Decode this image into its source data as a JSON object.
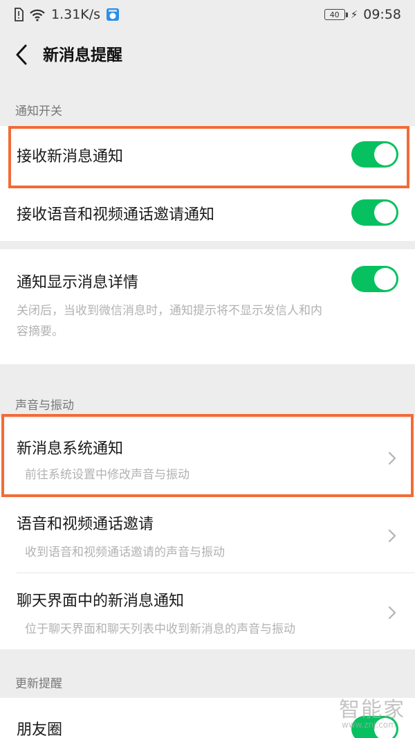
{
  "status_bar": {
    "speed": "1.31K/s",
    "battery": "40",
    "time": "09:58",
    "icons": [
      "sim-alert-icon",
      "wifi-icon",
      "app-notification-icon",
      "charging-icon"
    ]
  },
  "header": {
    "title": "新消息提醒"
  },
  "sections": {
    "notify": {
      "header": "通知开关",
      "items": [
        {
          "title": "接收新消息通知",
          "toggle": true
        },
        {
          "title": "接收语音和视频通话邀请通知",
          "toggle": true
        }
      ]
    },
    "detail": {
      "title": "通知显示消息详情",
      "toggle": true,
      "desc_line1": "关闭后，当收到微信消息时，通知提示将不显示发信人和内",
      "desc_line2": "容摘要。"
    },
    "sound": {
      "header": "声音与振动",
      "items": [
        {
          "title": "新消息系统通知",
          "subtitle": "前往系统设置中修改声音与振动"
        },
        {
          "title": "语音和视频通话邀请",
          "subtitle": "收到语音和视频通话邀请的声音与振动"
        },
        {
          "title": "聊天界面中的新消息通知",
          "subtitle": "位于聊天界面和聊天列表中收到新消息的声音与振动"
        }
      ]
    },
    "update": {
      "header": "更新提醒",
      "items": [
        {
          "title": "朋友圈",
          "toggle": true
        }
      ]
    }
  },
  "colors": {
    "toggle_on": "#07c160",
    "highlight": "#f26b38",
    "background": "#ededed"
  },
  "watermark": {
    "text": "智能家",
    "url": "www.znj.com"
  }
}
